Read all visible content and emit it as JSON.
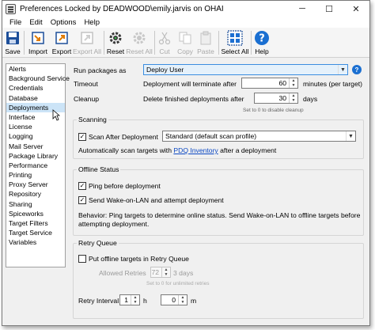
{
  "window": {
    "title": "Preferences Locked by DEADWOOD\\emily.jarvis on OHAI",
    "controls": {
      "minimize": "─",
      "maximize": "☐",
      "close": "✕"
    }
  },
  "menu": [
    "File",
    "Edit",
    "Options",
    "Help"
  ],
  "toolbar": {
    "save": "Save",
    "import": "Import",
    "export": "Export",
    "export_all": "Export All",
    "reset": "Reset",
    "reset_all": "Reset All",
    "cut": "Cut",
    "copy": "Copy",
    "paste": "Paste",
    "select_all": "Select All",
    "help": "Help"
  },
  "sidebar": {
    "items": [
      "Alerts",
      "Background Service",
      "Credentials",
      "Database",
      "Deployments",
      "Interface",
      "License",
      "Logging",
      "Mail Server",
      "Package Library",
      "Performance",
      "Printing",
      "Proxy Server",
      "Repository",
      "Sharing",
      "Spiceworks",
      "Target Filters",
      "Target Service",
      "Variables"
    ],
    "selected": "Deployments"
  },
  "deployments": {
    "run_packages_label": "Run packages as",
    "run_packages_value": "Deploy User",
    "timeout_label": "Timeout",
    "timeout_text": "Deployment will terminate after",
    "timeout_value": "60",
    "timeout_unit": "minutes (per target)",
    "cleanup_label": "Cleanup",
    "cleanup_text": "Delete finished deployments after",
    "cleanup_value": "30",
    "cleanup_unit": "days",
    "cleanup_hint": "Set to 0 to disable cleanup"
  },
  "scanning": {
    "title": "Scanning",
    "scan_after_label": "Scan After Deployment",
    "scan_after_checked": true,
    "scan_profile_value": "Standard (default scan profile)",
    "info_prefix": "Automatically scan targets with ",
    "info_link": "PDQ Inventory",
    "info_suffix": " after a deployment"
  },
  "offline": {
    "title": "Offline Status",
    "ping_label": "Ping before deployment",
    "ping_checked": true,
    "wol_label": "Send Wake-on-LAN and attempt deployment",
    "wol_checked": true,
    "behavior_line1": "Behavior: Ping targets to determine online status. Send Wake-on-LAN to offline targets before",
    "behavior_line2": "attempting deployment."
  },
  "retry": {
    "title": "Retry Queue",
    "put_offline_label": "Put offline targets in Retry Queue",
    "put_offline_checked": false,
    "allowed_retries_label": "Allowed Retries",
    "allowed_retries_value": "72",
    "allowed_retries_unit": "3 days",
    "allowed_retries_hint": "Set to 0 for unlimited retries",
    "retry_interval_label": "Retry Interval",
    "interval_hours_value": "1",
    "interval_hours_unit": "h",
    "interval_minutes_value": "0",
    "interval_minutes_unit": "m"
  }
}
